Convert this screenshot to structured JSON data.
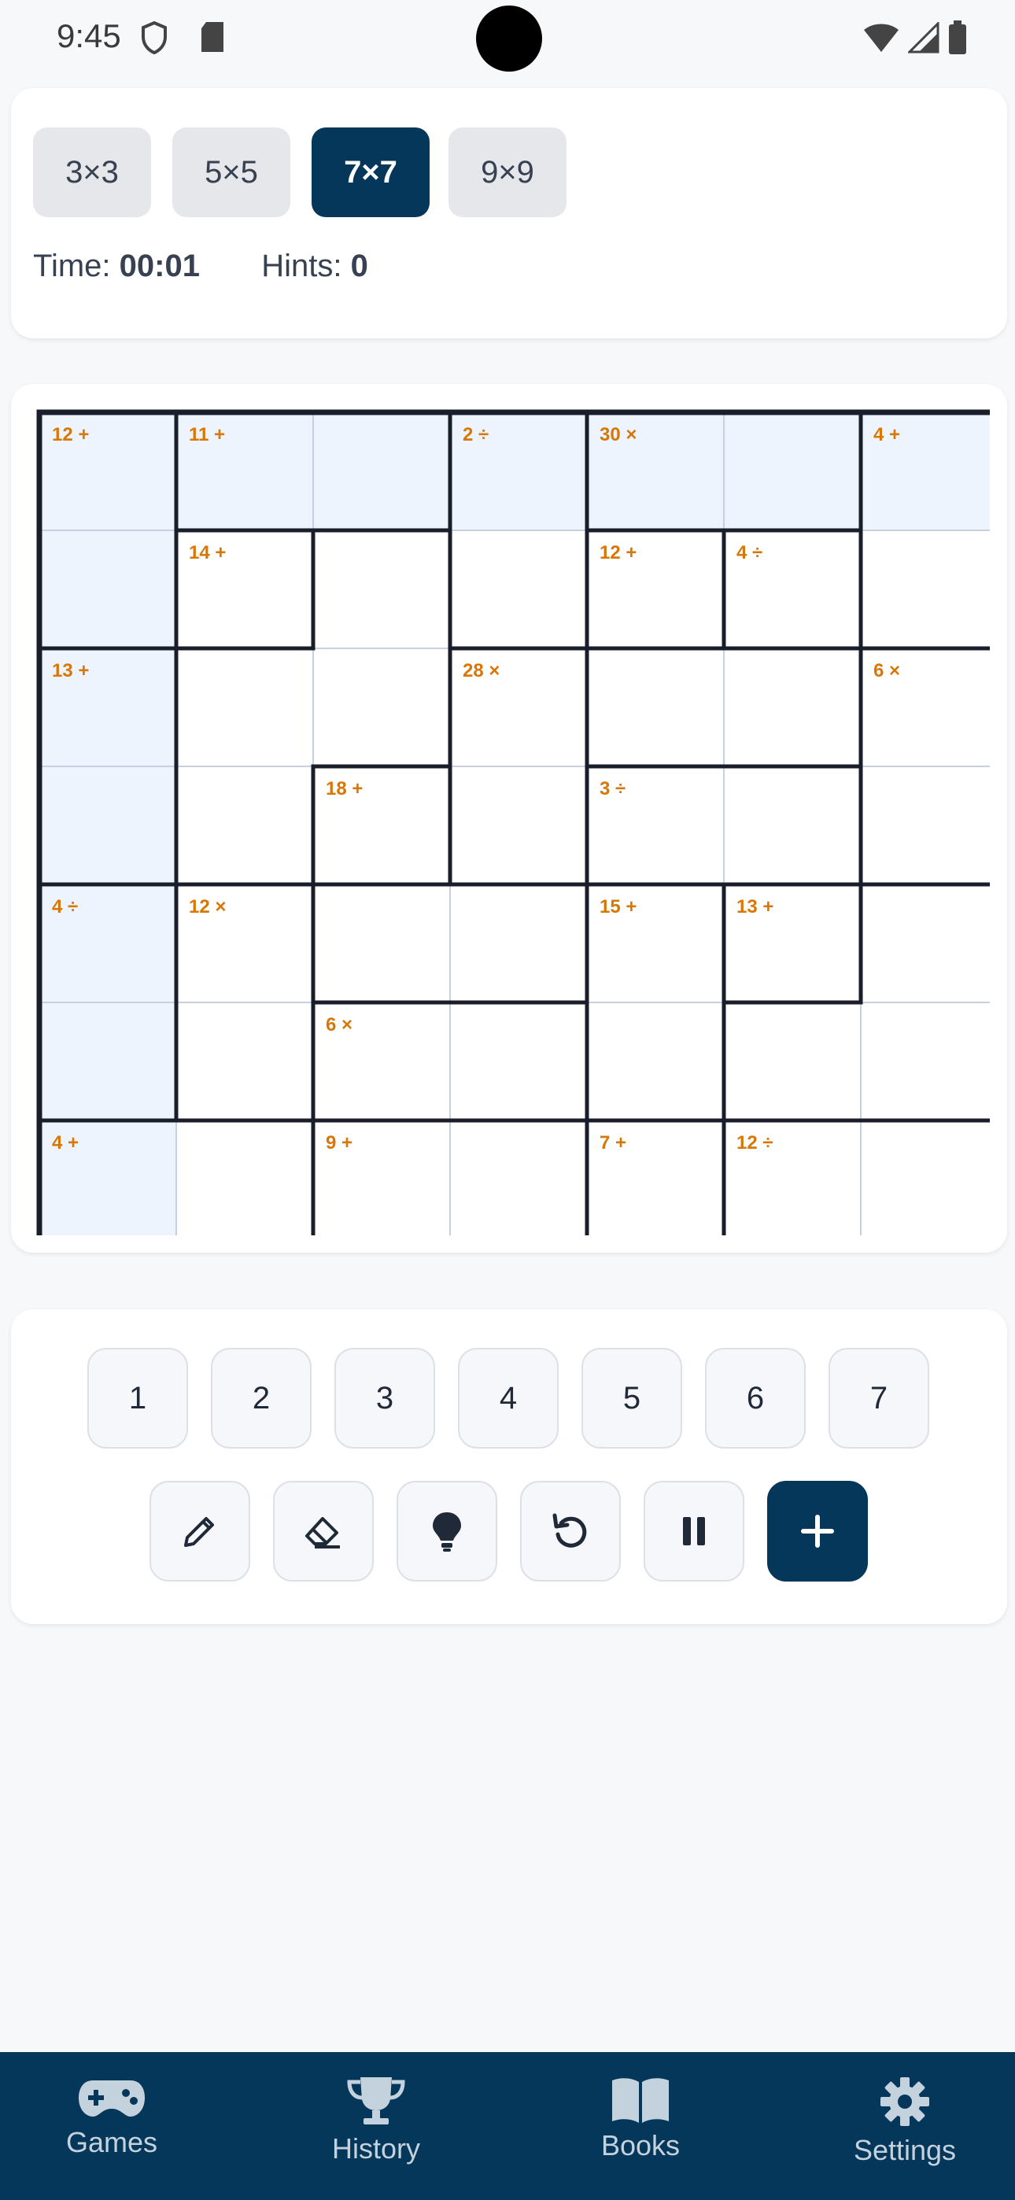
{
  "status_bar": {
    "time": "9:45"
  },
  "size_selector": {
    "options": [
      {
        "label": "3×3",
        "active": false
      },
      {
        "label": "5×5",
        "active": false
      },
      {
        "label": "7×7",
        "active": true
      },
      {
        "label": "9×9",
        "active": false
      }
    ]
  },
  "game_info": {
    "time_label": "Time:",
    "time_value": "00:01",
    "hints_label": "Hints:",
    "hints_value": "0"
  },
  "board": {
    "size": 7,
    "cages": [
      {
        "label": "12 +",
        "cells": [
          [
            0,
            0
          ],
          [
            1,
            0
          ]
        ]
      },
      {
        "label": "11 +",
        "cells": [
          [
            0,
            1
          ],
          [
            0,
            2
          ]
        ]
      },
      {
        "label": "2 ÷",
        "cells": [
          [
            0,
            3
          ],
          [
            1,
            3
          ]
        ]
      },
      {
        "label": "30 ×",
        "cells": [
          [
            0,
            4
          ],
          [
            0,
            5
          ]
        ]
      },
      {
        "label": "4 +",
        "cells": [
          [
            0,
            6
          ],
          [
            1,
            6
          ]
        ]
      },
      {
        "label": "14 +",
        "cells": [
          [
            1,
            1
          ]
        ]
      },
      {
        "label": "12 +",
        "cells": [
          [
            1,
            4
          ]
        ]
      },
      {
        "label": "4 ÷",
        "cells": [
          [
            1,
            5
          ]
        ]
      },
      {
        "label": "13 +",
        "cells": [
          [
            2,
            0
          ],
          [
            3,
            0
          ]
        ]
      },
      {
        "label": "28 ×",
        "cells": [
          [
            2,
            3
          ],
          [
            3,
            3
          ]
        ]
      },
      {
        "label": "6 ×",
        "cells": [
          [
            2,
            6
          ],
          [
            3,
            6
          ]
        ]
      },
      {
        "label": "18 +",
        "cells": [
          [
            3,
            2
          ]
        ]
      },
      {
        "label": "3 ÷",
        "cells": [
          [
            3,
            4
          ],
          [
            3,
            5
          ]
        ]
      },
      {
        "label": "4 ÷",
        "cells": [
          [
            4,
            0
          ],
          [
            5,
            0
          ]
        ]
      },
      {
        "label": "12 ×",
        "cells": [
          [
            4,
            1
          ],
          [
            5,
            1
          ]
        ]
      },
      {
        "label": "15 +",
        "cells": [
          [
            4,
            4
          ],
          [
            5,
            4
          ]
        ]
      },
      {
        "label": "13 +",
        "cells": [
          [
            4,
            5
          ]
        ]
      },
      {
        "label": "6 ×",
        "cells": [
          [
            5,
            2
          ],
          [
            5,
            3
          ]
        ]
      },
      {
        "label": "4 +",
        "cells": [
          [
            6,
            0
          ],
          [
            6,
            1
          ]
        ]
      },
      {
        "label": "9 +",
        "cells": [
          [
            6,
            2
          ],
          [
            6,
            3
          ]
        ]
      },
      {
        "label": "7 +",
        "cells": [
          [
            6,
            4
          ]
        ]
      },
      {
        "label": "12 ÷",
        "cells": [
          [
            6,
            5
          ],
          [
            6,
            6
          ]
        ]
      }
    ],
    "highlighted_cells": [
      [
        0,
        0
      ],
      [
        0,
        1
      ],
      [
        0,
        2
      ],
      [
        0,
        3
      ],
      [
        0,
        4
      ],
      [
        0,
        5
      ],
      [
        0,
        6
      ],
      [
        1,
        0
      ],
      [
        2,
        0
      ],
      [
        3,
        0
      ],
      [
        4,
        0
      ],
      [
        5,
        0
      ],
      [
        6,
        0
      ]
    ]
  },
  "number_pad": [
    "1",
    "2",
    "3",
    "4",
    "5",
    "6",
    "7"
  ],
  "tools": [
    {
      "name": "pencil-button",
      "icon": "pencil-icon"
    },
    {
      "name": "eraser-button",
      "icon": "eraser-icon"
    },
    {
      "name": "hint-button",
      "icon": "lightbulb-icon"
    },
    {
      "name": "undo-button",
      "icon": "undo-icon"
    },
    {
      "name": "pause-button",
      "icon": "pause-icon"
    },
    {
      "name": "new-game-button",
      "icon": "plus-icon"
    }
  ],
  "bottom_nav": [
    {
      "label": "Games",
      "icon": "gamepad-icon"
    },
    {
      "label": "History",
      "icon": "trophy-icon"
    },
    {
      "label": "Books",
      "icon": "book-icon"
    },
    {
      "label": "Settings",
      "icon": "gear-icon"
    }
  ],
  "colors": {
    "primary": "#05375a",
    "cage_label": "#d97706",
    "highlight": "#eef4fd",
    "grid_line": "#c7cfe0",
    "cage_border": "#1a1d2a"
  }
}
